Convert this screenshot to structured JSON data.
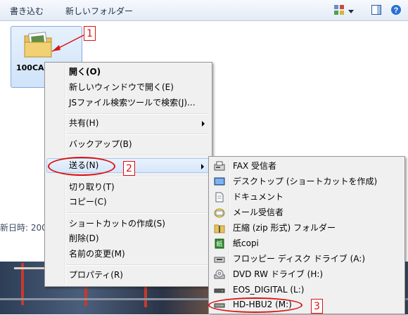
{
  "toolbar": {
    "burn": "書き込む",
    "new_folder": "新しいフォルダー"
  },
  "folder": {
    "name": "100CAN"
  },
  "status_partial": "新日時: 2009",
  "context_menu": {
    "items": [
      {
        "label": "開く(O)"
      },
      {
        "label": "新しいウィンドウで開く(E)"
      },
      {
        "label": "JSファイル検索ツールで検索(J)..."
      },
      {
        "label": "共有(H)"
      },
      {
        "label": "バックアップ(B)"
      },
      {
        "label": "送る(N)"
      },
      {
        "label": "切り取り(T)"
      },
      {
        "label": "コピー(C)"
      },
      {
        "label": "ショートカットの作成(S)"
      },
      {
        "label": "削除(D)"
      },
      {
        "label": "名前の変更(M)"
      },
      {
        "label": "プロパティ(R)"
      }
    ]
  },
  "send_to_menu": {
    "items": [
      {
        "label": "FAX 受信者",
        "icon": "fax-icon"
      },
      {
        "label": "デスクトップ (ショートカットを作成)",
        "icon": "desktop-icon"
      },
      {
        "label": "ドキュメント",
        "icon": "document-icon"
      },
      {
        "label": "メール受信者",
        "icon": "mail-recipient-icon"
      },
      {
        "label": "圧縮 (zip 形式) フォルダー",
        "icon": "zip-folder-icon"
      },
      {
        "label": "紙copi",
        "icon": "kamicopi-icon"
      },
      {
        "label": "フロッピー ディスク ドライブ (A:)",
        "icon": "floppy-drive-icon"
      },
      {
        "label": "DVD RW ドライブ (H:)",
        "icon": "dvd-drive-icon"
      },
      {
        "label": "EOS_DIGITAL (L:)",
        "icon": "removable-drive-icon"
      },
      {
        "label": "HD-HBU2 (M:)",
        "icon": "hard-drive-icon"
      }
    ]
  },
  "callouts": {
    "one": "1",
    "two": "2",
    "three": "3"
  },
  "colors": {
    "annotation": "#dd1111",
    "selection": "#cfe3fa",
    "menu_bg": "#f0f0f0"
  }
}
